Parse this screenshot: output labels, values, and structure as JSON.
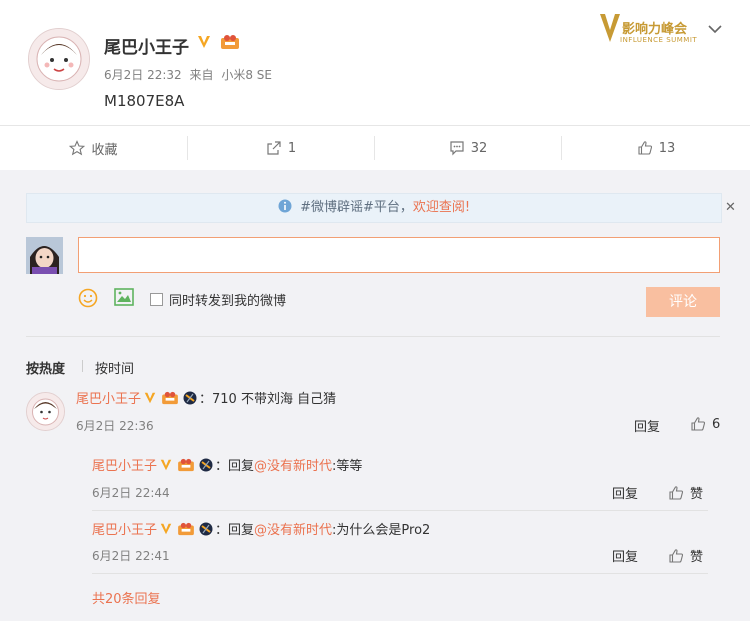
{
  "post": {
    "username": "尾巴小王子",
    "date": "6月2日 22:32",
    "source_prefix": "来自",
    "source": "小米8 SE",
    "content": "M1807E8A"
  },
  "brand": {
    "name": "影响力峰会",
    "sub": "INFLUENCE SUMMIT"
  },
  "actions": {
    "collect": "收藏",
    "repost": "1",
    "comment": "32",
    "like": "13"
  },
  "notice": {
    "tag": "#微博辟谣#平台，",
    "welcome": "欢迎查阅!"
  },
  "composer": {
    "input_value": "",
    "placeholder": "",
    "forward_label": "同时转发到我的微博",
    "submit_label": "评论"
  },
  "sort": {
    "hot": "按热度",
    "time": "按时间"
  },
  "comments": [
    {
      "name": "尾巴小王子",
      "text": "：710  不带刘海 自己猜",
      "time": "6月2日 22:36",
      "reply": "回复",
      "likes": "6"
    }
  ],
  "subcomments": [
    {
      "name": "尾巴小王子",
      "prefix": "：回复",
      "mention": "@没有新时代",
      "text": ":等等",
      "time": "6月2日 22:44",
      "reply": "回复",
      "like": "赞"
    },
    {
      "name": "尾巴小王子",
      "prefix": "：回复",
      "mention": "@没有新时代",
      "text": ":为什么会是Pro2",
      "time": "6月2日 22:41",
      "reply": "回复",
      "like": "赞"
    }
  ],
  "more_replies": "共20条回复",
  "colors": {
    "accent": "#eb7350",
    "badge_gold": "#f5a623",
    "notice_bg": "#eaf2f9"
  },
  "icons": [
    "star-icon",
    "share-icon",
    "comment-icon",
    "thumb-up-icon",
    "info-icon",
    "close-icon",
    "emoji-icon",
    "image-icon",
    "chevron-down-icon",
    "verified-v-icon",
    "member-icon",
    "medal-icon"
  ]
}
